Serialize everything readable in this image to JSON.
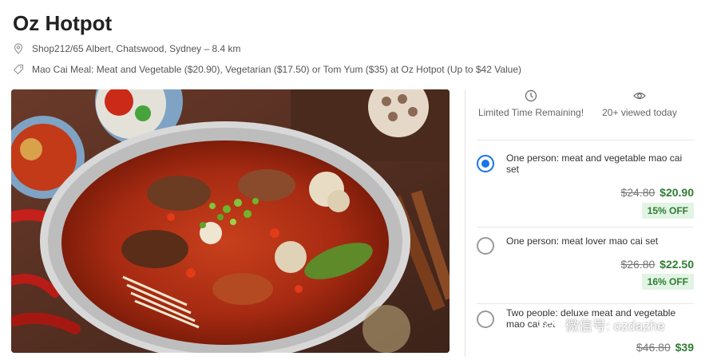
{
  "restaurant": {
    "name": "Oz Hotpot",
    "address": "Shop212/65 Albert, Chatswood, Sydney – 8.4 km",
    "deal": "Mao Cai Meal: Meat and Vegetable ($20.90), Vegetarian ($17.50) or Tom Yum ($35) at Oz Hotpot (Up to $42 Value)",
    "address_icon": "location-pin-icon",
    "deal_icon": "tag-icon"
  },
  "stats": [
    {
      "label": "Limited Time Remaining!",
      "icon": "clock-icon"
    },
    {
      "label": "20+ viewed today",
      "icon": "eye-icon"
    }
  ],
  "options": [
    {
      "name": "One person: meat and vegetable mao cai set",
      "old_price": "$24.80",
      "new_price": "$20.90",
      "discount": "15% OFF",
      "selected": true
    },
    {
      "name": "One person: meat lover mao cai set",
      "old_price": "$26.80",
      "new_price": "$22.50",
      "discount": "16% OFF",
      "selected": false
    },
    {
      "name": "Two people: deluxe meat and vegetable mao cai set",
      "old_price": "$46.80",
      "new_price": "$39",
      "discount": "",
      "selected": false
    }
  ],
  "watermark": {
    "text": "微信号: ozdazhe",
    "icon": "wechat-icon"
  },
  "colors": {
    "accent": "#1a73e8",
    "price_green": "#2e7d32",
    "discount_bg": "#e2f4e4"
  }
}
